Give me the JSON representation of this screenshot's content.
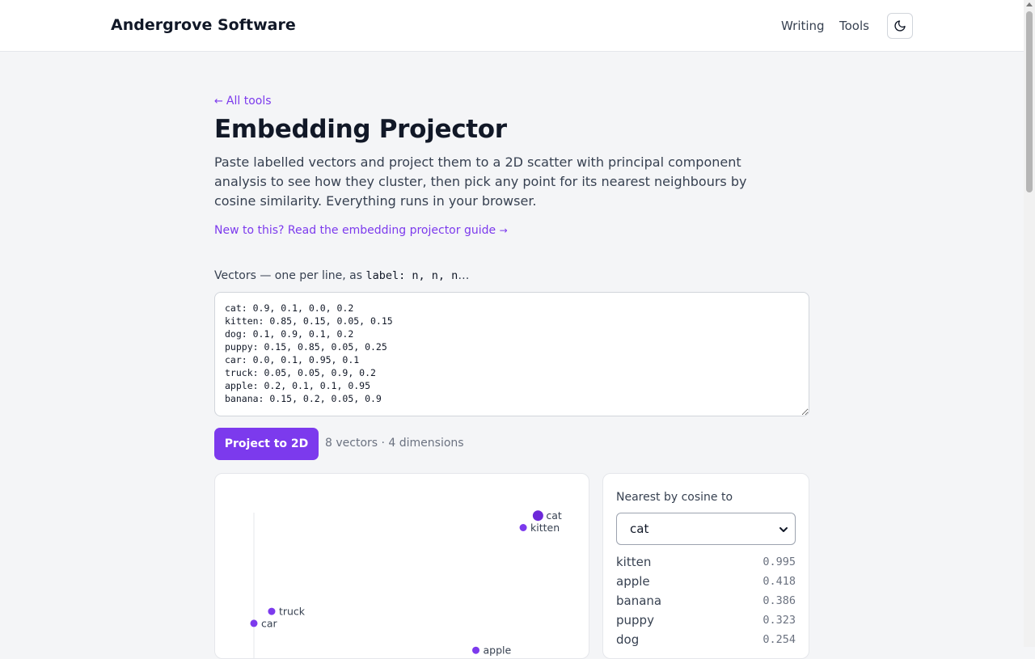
{
  "header": {
    "brand": "Andergrove Software",
    "nav": [
      "Writing",
      "Tools"
    ],
    "theme_icon": "moon-icon"
  },
  "page": {
    "back_arrow": "←",
    "back_link": "All tools",
    "title": "Embedding Projector",
    "description": "Paste labelled vectors and project them to a 2D scatter with principal component analysis to see how they cluster, then pick any point for its nearest neighbours by cosine similarity. Everything runs in your browser.",
    "guide_link": "New to this? Read the embedding projector guide",
    "guide_arrow": "→",
    "input_label_prefix": "Vectors — one per line, as",
    "input_label_code": "label: n, n, n",
    "input_label_suffix": "…",
    "vectors_text": "cat: 0.9, 0.1, 0.0, 0.2\nkitten: 0.85, 0.15, 0.05, 0.15\ndog: 0.1, 0.9, 0.1, 0.2\npuppy: 0.15, 0.85, 0.05, 0.25\ncar: 0.0, 0.1, 0.95, 0.1\ntruck: 0.05, 0.05, 0.9, 0.2\napple: 0.2, 0.1, 0.1, 0.95\nbanana: 0.15, 0.2, 0.05, 0.9",
    "project_button": "Project to 2D",
    "stats": "8 vectors · 4 dimensions"
  },
  "neighbours": {
    "title": "Nearest by cosine to",
    "selected": "cat",
    "options": [
      "cat",
      "kitten",
      "dog",
      "puppy",
      "car",
      "truck",
      "apple",
      "banana"
    ],
    "results": [
      {
        "label": "kitten",
        "score": "0.995"
      },
      {
        "label": "apple",
        "score": "0.418"
      },
      {
        "label": "banana",
        "score": "0.386"
      },
      {
        "label": "puppy",
        "score": "0.323"
      },
      {
        "label": "dog",
        "score": "0.254"
      }
    ]
  },
  "chart_data": {
    "type": "scatter",
    "selected_point": "cat",
    "accent_color": "#7c3aed",
    "selected_color": "#6d28d9",
    "points": [
      {
        "label": "cat",
        "x": 0.96,
        "y": 0.99
      },
      {
        "label": "kitten",
        "x": 0.91,
        "y": 0.95
      },
      {
        "label": "truck",
        "x": 0.06,
        "y": 0.67
      },
      {
        "label": "car",
        "x": 0.0,
        "y": 0.63
      },
      {
        "label": "apple",
        "x": 0.75,
        "y": 0.54
      }
    ]
  }
}
